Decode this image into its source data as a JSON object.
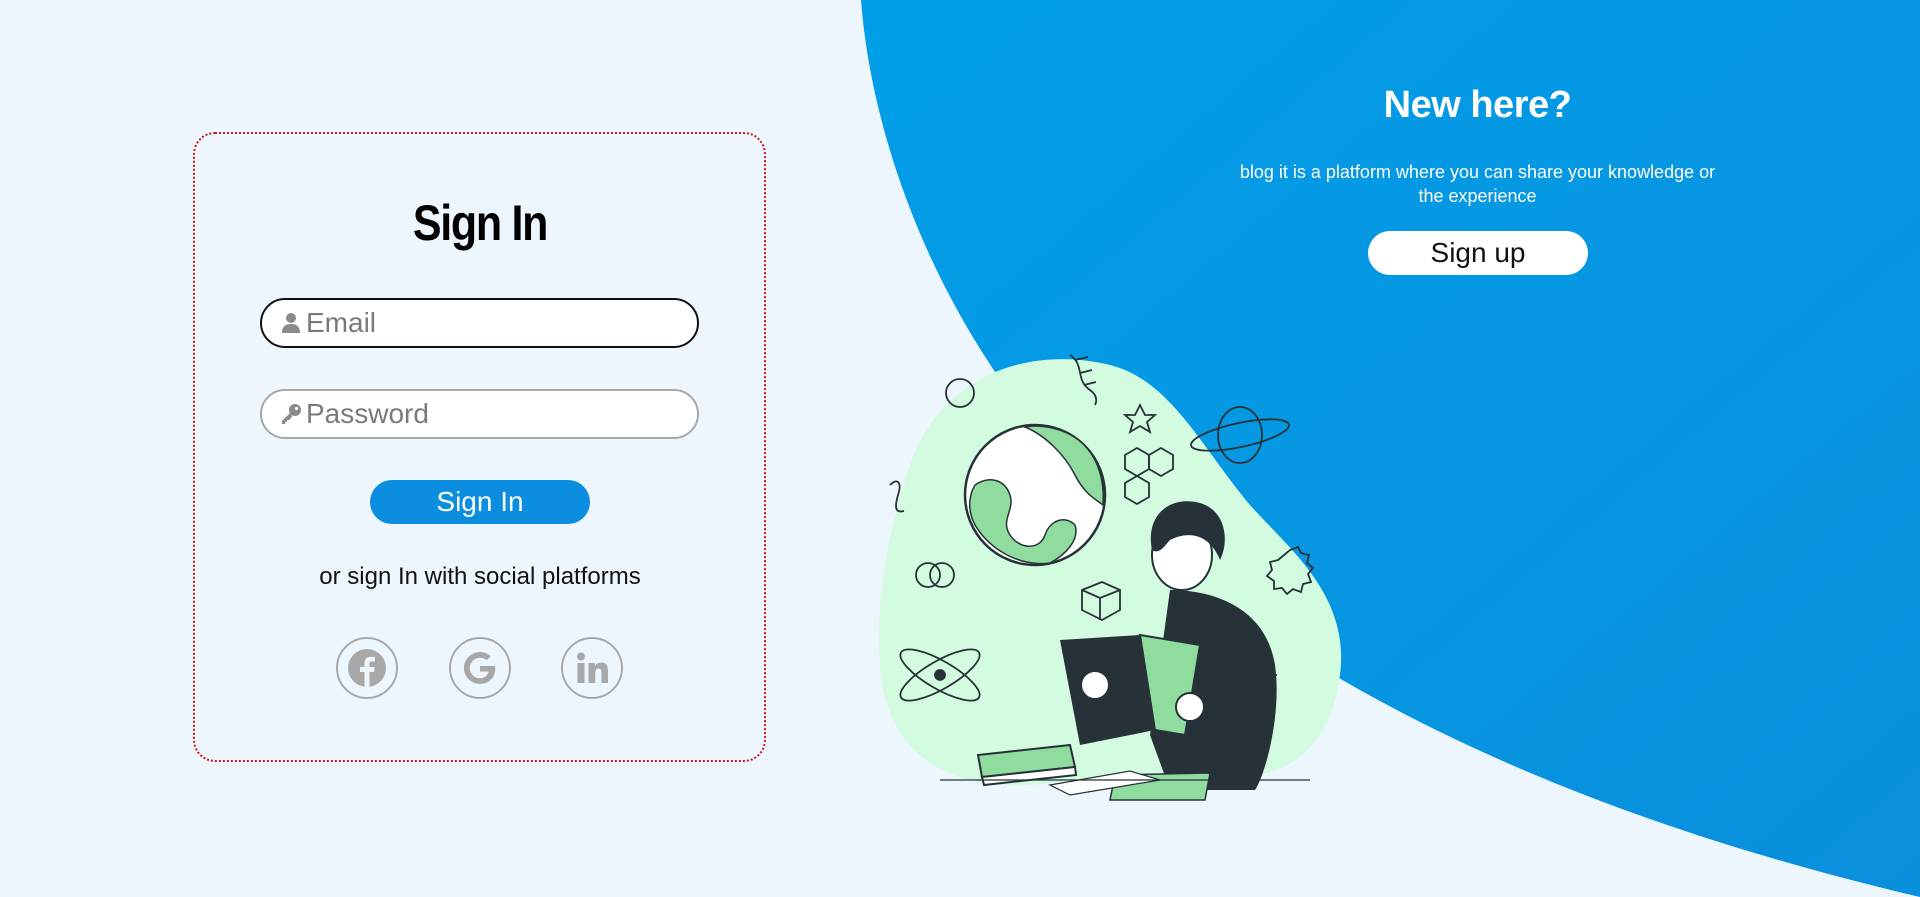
{
  "colors": {
    "background": "#eef6fd",
    "accent_blue": "#0b8de0",
    "panel_blue": "#019ae6",
    "card_border": "#d0161e",
    "illustration_blob": "#d3fbe0",
    "illustration_green": "#8fdc9e"
  },
  "signin": {
    "title": "Sign In",
    "email": {
      "placeholder": "Email",
      "value": "",
      "icon": "user-icon"
    },
    "password": {
      "placeholder": "Password",
      "value": "",
      "icon": "key-icon"
    },
    "submit_label": "Sign In",
    "social_text": "or sign In with social platforms",
    "social": [
      {
        "name": "facebook",
        "icon": "facebook-icon"
      },
      {
        "name": "google",
        "icon": "google-icon"
      },
      {
        "name": "linkedin",
        "icon": "linkedin-icon"
      }
    ]
  },
  "promo": {
    "title": "New here?",
    "text": "blog it is a platform where you can share your knowledge or the experience",
    "signup_label": "Sign up"
  },
  "illustration": {
    "icon": "person-reading-book-illustration"
  }
}
